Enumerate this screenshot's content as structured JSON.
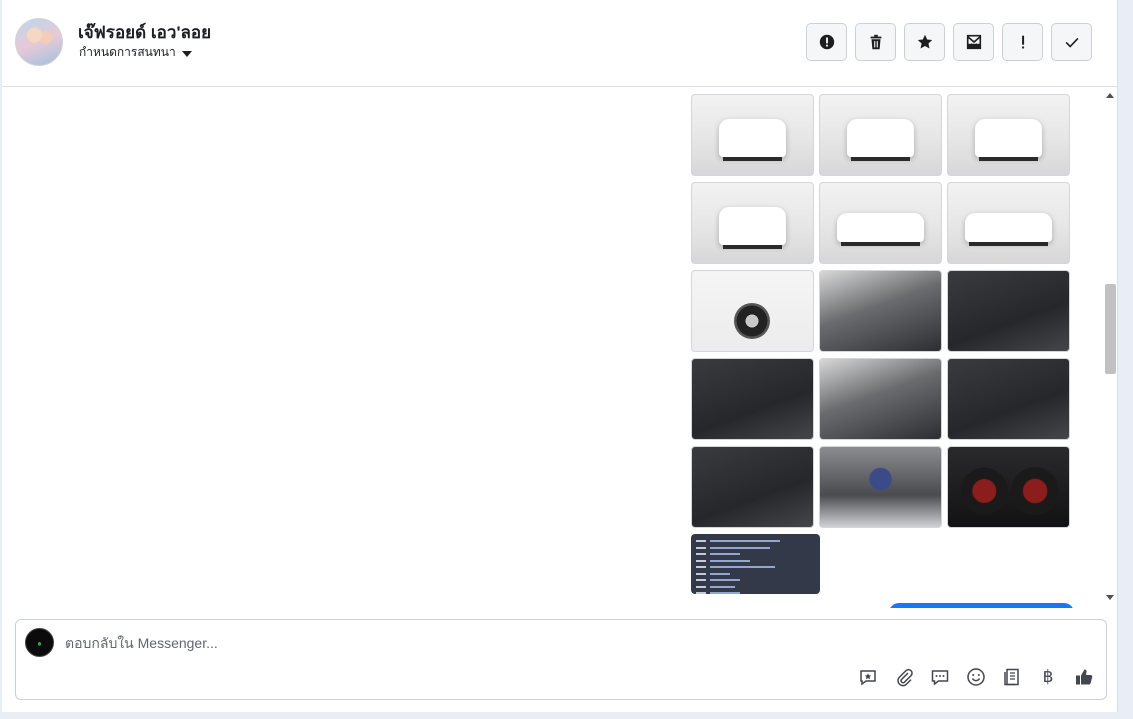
{
  "header": {
    "contact_name": "เจ๊ฟรอยด์ เอว'ลอย",
    "assign_label": "กำหนดการสนทนา",
    "actions": [
      {
        "icon": "alert-circle-icon"
      },
      {
        "icon": "trash-icon"
      },
      {
        "icon": "star-icon"
      },
      {
        "icon": "mark-unread-icon"
      },
      {
        "icon": "exclamation-icon"
      },
      {
        "icon": "check-icon"
      }
    ]
  },
  "thread": {
    "photos": [
      {
        "kind": "studio"
      },
      {
        "kind": "studio"
      },
      {
        "kind": "studio"
      },
      {
        "kind": "studio"
      },
      {
        "kind": "side"
      },
      {
        "kind": "side"
      },
      {
        "kind": "front"
      },
      {
        "kind": "interior-light"
      },
      {
        "kind": "interior"
      },
      {
        "kind": "interior"
      },
      {
        "kind": "interior-light"
      },
      {
        "kind": "interior"
      },
      {
        "kind": "interior"
      },
      {
        "kind": "engine"
      },
      {
        "kind": "gauge"
      }
    ]
  },
  "composer": {
    "placeholder": "ตอบกลับใน Messenger...",
    "tools": [
      "feedback-icon",
      "attachment-icon",
      "saved-reply-icon",
      "emoji-icon",
      "receipt-icon",
      "baht-icon",
      "like-icon"
    ],
    "currency_symbol": "฿"
  },
  "colors": {
    "accent": "#1877f2",
    "border": "#ccd0d5",
    "background": "#e9edf5"
  }
}
